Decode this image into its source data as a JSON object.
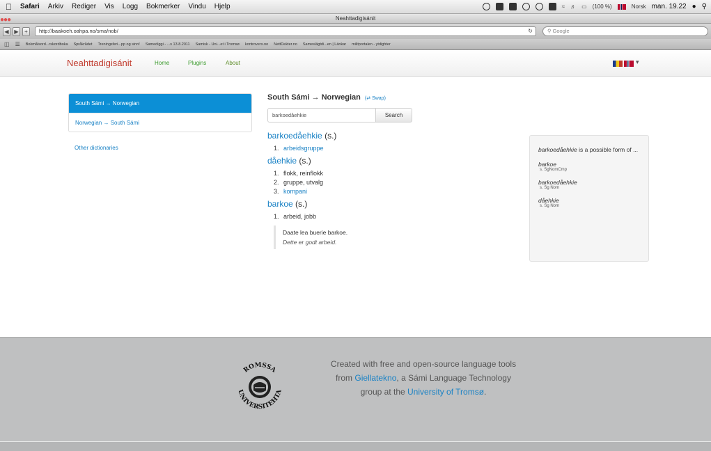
{
  "menubar": {
    "app_name": "Safari",
    "items": [
      "Arkiv",
      "Rediger",
      "Vis",
      "Logg",
      "Bokmerker",
      "Vindu",
      "Hjelp"
    ],
    "battery": "(100 %)",
    "input_lang": "Norsk",
    "clock": "man. 19.22"
  },
  "window": {
    "title": "Neahttadigisánit"
  },
  "toolbar": {
    "url": "http://baakoeh.oahpa.no/sma/nob/",
    "search_placeholder": "Google"
  },
  "bookmarks": [
    "Bokmålsord...rskordboka",
    "Språkrådet",
    "Treningsferi...pp og sinn!",
    "Samediggi - ...s 13.8.2011",
    "Samisk - Uni...et i Tromsø",
    "kontrovers.no",
    "NettDekter.no",
    "Sameslägtdi...en | Länkar",
    "militportalen - ytdighter"
  ],
  "site": {
    "brand": "Neahttadigisánit",
    "nav": {
      "home": "Home",
      "plugins": "Plugins",
      "about": "About"
    }
  },
  "sidebar": {
    "items": [
      {
        "label": "South Sámi → Norwegian"
      },
      {
        "label": "Norwegian → South Sámi"
      }
    ],
    "other": "Other dictionaries"
  },
  "main": {
    "title": "South Sámi → Norwegian",
    "swap": "(⇄ Swap)",
    "search_value": "barkoedåehkie",
    "search_button": "Search",
    "entries": [
      {
        "lemma": "barkoedåehkie",
        "pos": "(s.)",
        "senses": [
          {
            "num": "1.",
            "text": "arbeidsgruppe"
          }
        ]
      },
      {
        "lemma": "dåehkie",
        "pos": "(s.)",
        "senses": [
          {
            "num": "1.",
            "text": "flokk, reinflokk"
          },
          {
            "num": "2.",
            "text": "gruppe, utvalg"
          },
          {
            "num": "3.",
            "text": "kompani"
          }
        ]
      },
      {
        "lemma": "barkoe",
        "pos": "(s.)",
        "senses": [
          {
            "num": "1.",
            "text": "arbeid, jobb"
          }
        ],
        "example": {
          "source": "Daate lea buerie barkoe.",
          "translation": "Dette er godt arbeid."
        }
      }
    ]
  },
  "analysis": {
    "word": "barkoedåehkie",
    "intro_rest": " is a possible form of ...",
    "items": [
      {
        "lemma": "barkoe",
        "tag": "s. SgNomCmp"
      },
      {
        "lemma": "barkoedåehkie",
        "tag": "s. Sg Nom"
      },
      {
        "lemma": "dåehkie",
        "tag": "s. Sg Nom"
      }
    ]
  },
  "footer": {
    "line1": "Created with free and open-source language tools",
    "line2_pre": "from ",
    "line2_link": "Giellatekno",
    "line2_post": ", a Sámi Language Technology",
    "line3_pre": "group at the ",
    "line3_link": "University of Tromsø",
    "line3_post": ".",
    "seal_top": "ROMSSA",
    "seal_bottom": "UNIVERSITEHTA"
  }
}
